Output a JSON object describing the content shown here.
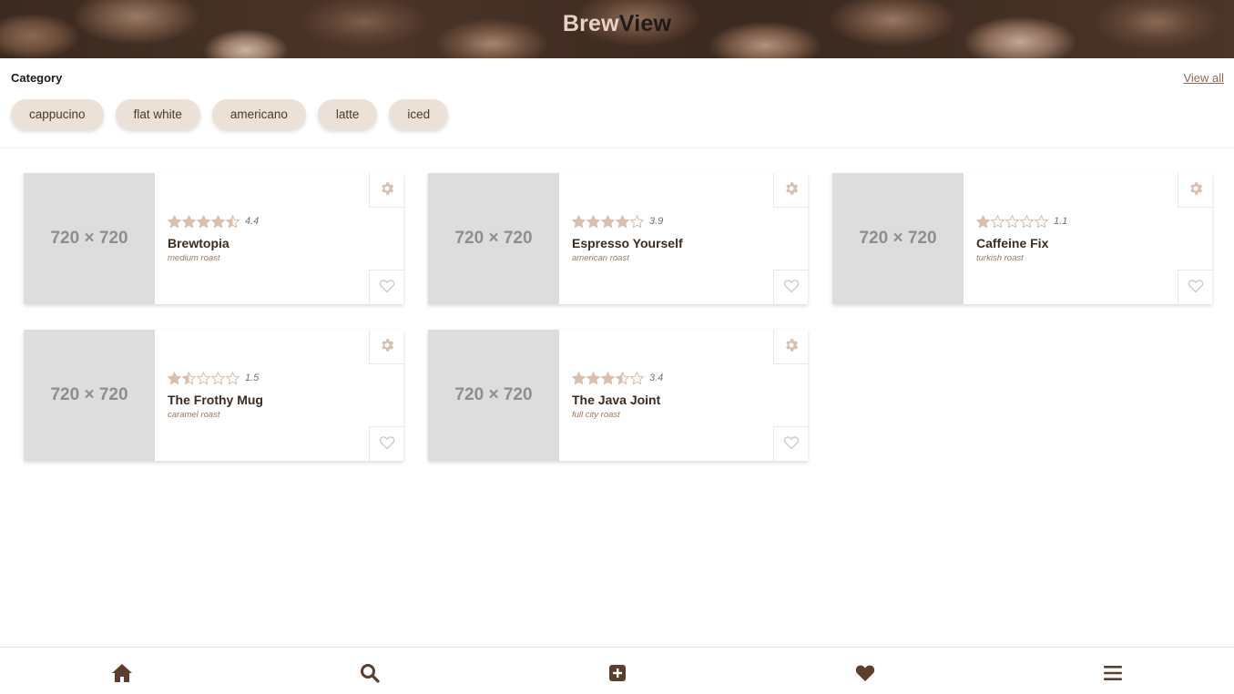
{
  "header": {
    "title_part1": "Brew",
    "title_part2": "View"
  },
  "category": {
    "label": "Category",
    "view_all": "View all",
    "chips": [
      "cappucino",
      "flat white",
      "americano",
      "latte",
      "iced"
    ]
  },
  "colors": {
    "accent": "#d9bfad",
    "brand_dark": "#5b3f2c",
    "chip_bg": "#ece1d7"
  },
  "cards": [
    {
      "placeholder": "720 × 720",
      "rating": "4.4",
      "rating_value": 4.4,
      "name": "Brewtopia",
      "roast": "medium roast"
    },
    {
      "placeholder": "720 × 720",
      "rating": "3.9",
      "rating_value": 3.9,
      "name": "Espresso Yourself",
      "roast": "american roast"
    },
    {
      "placeholder": "720 × 720",
      "rating": "1.1",
      "rating_value": 1.1,
      "name": "Caffeine Fix",
      "roast": "turkish roast"
    },
    {
      "placeholder": "720 × 720",
      "rating": "1.5",
      "rating_value": 1.5,
      "name": "The Frothy Mug",
      "roast": "caramel roast"
    },
    {
      "placeholder": "720 × 720",
      "rating": "3.4",
      "rating_value": 3.4,
      "name": "The Java Joint",
      "roast": "full city roast"
    }
  ],
  "card_icons": {
    "settings": "gear-icon",
    "favorite": "heart-outline-icon"
  },
  "bottom_nav": [
    {
      "name": "home",
      "icon": "home-icon"
    },
    {
      "name": "search",
      "icon": "search-icon"
    },
    {
      "name": "add",
      "icon": "plus-square-icon"
    },
    {
      "name": "favorites",
      "icon": "heart-icon"
    },
    {
      "name": "menu",
      "icon": "menu-icon"
    }
  ]
}
